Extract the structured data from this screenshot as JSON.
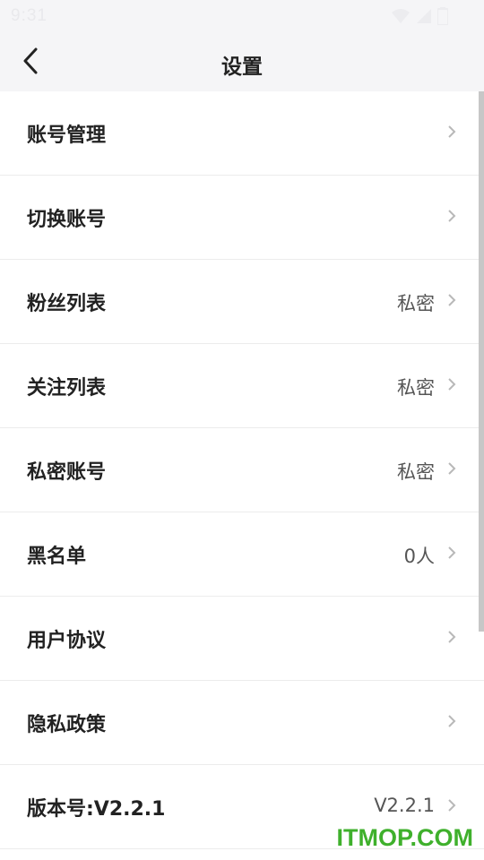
{
  "status_bar": {
    "time": "9:31",
    "icons": [
      "wifi-icon",
      "signal-icon",
      "battery-icon"
    ]
  },
  "header": {
    "back_icon": "chevron-left-icon",
    "title": "设置"
  },
  "settings": [
    {
      "label": "账号管理",
      "value": ""
    },
    {
      "label": "切换账号",
      "value": ""
    },
    {
      "label": "粉丝列表",
      "value": "私密"
    },
    {
      "label": "关注列表",
      "value": "私密"
    },
    {
      "label": "私密账号",
      "value": "私密"
    },
    {
      "label": "黑名单",
      "value": "0人"
    },
    {
      "label": "用户协议",
      "value": ""
    },
    {
      "label": "隐私政策",
      "value": ""
    },
    {
      "label": "版本号:V2.2.1",
      "value": "V2.2.1"
    }
  ],
  "watermark": "ITMOP.COM",
  "colors": {
    "background": "#ffffff",
    "header_background": "#f5f5f7",
    "text_primary": "#222222",
    "text_secondary": "#555555",
    "chevron": "#b8b8b8",
    "divider": "#ececec",
    "watermark": "#3fb02c"
  }
}
